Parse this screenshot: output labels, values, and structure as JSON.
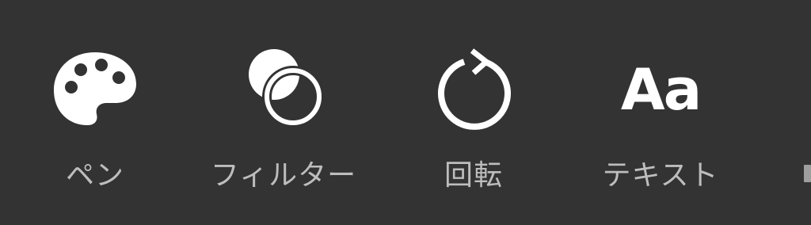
{
  "toolbar": {
    "background": "#333333",
    "label_color": "#bdbdbd",
    "icon_color": "#ffffff",
    "tools": [
      {
        "id": "pen",
        "label": "ペン",
        "icon": "palette-icon"
      },
      {
        "id": "filter",
        "label": "フィルター",
        "icon": "overlapping-circles-icon"
      },
      {
        "id": "rotate",
        "label": "回転",
        "icon": "rotate-clockwise-icon"
      },
      {
        "id": "text",
        "label": "テキスト",
        "icon": "text-aa-icon",
        "icon_text": "Aa"
      }
    ]
  }
}
